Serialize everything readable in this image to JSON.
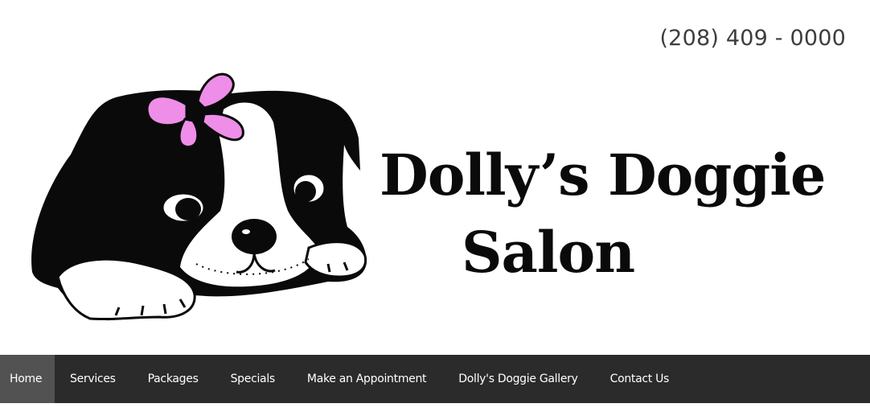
{
  "header": {
    "phone": "(208) 409 - 0000",
    "title_line1": "Dolly’s Doggie",
    "title_line2": "Salon",
    "colors": {
      "bow": "#ee8ee8",
      "ink": "#0a0a0a"
    }
  },
  "nav": {
    "background": "#2b2b2b",
    "active_background": "#525252",
    "items": [
      {
        "label": "Home",
        "active": true
      },
      {
        "label": "Services",
        "active": false
      },
      {
        "label": "Packages",
        "active": false
      },
      {
        "label": "Specials",
        "active": false
      },
      {
        "label": "Make an Appointment",
        "active": false
      },
      {
        "label": "Dolly's Doggie Gallery",
        "active": false
      },
      {
        "label": "Contact Us",
        "active": false
      }
    ]
  }
}
